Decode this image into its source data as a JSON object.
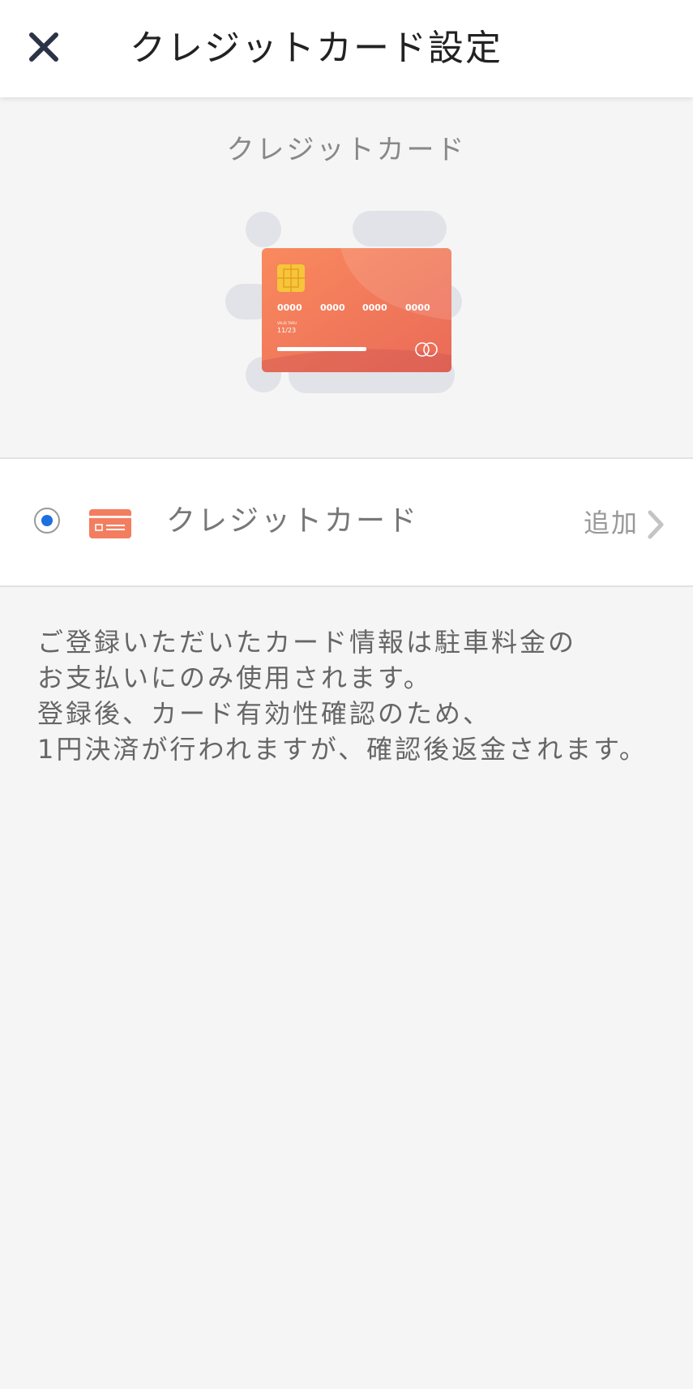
{
  "header": {
    "title": "クレジットカード設定",
    "close_icon": "close-icon"
  },
  "hero": {
    "label": "クレジットカード",
    "card": {
      "number_groups": [
        "0000",
        "0000",
        "0000",
        "0000"
      ],
      "valid_thru_label": "VALID THRU",
      "expiry": "11/23"
    }
  },
  "payment_method": {
    "selected": true,
    "icon": "credit-card-icon",
    "label": "クレジットカード",
    "action_label": "追加",
    "chevron_icon": "chevron-right-icon"
  },
  "notice": {
    "lines": [
      "ご登録いただいたカード情報は駐車料金の",
      "お支払いにのみ使用されます。",
      "登録後、カード有効性確認のため、",
      "1円決済が行われますが、確認後返金されます。"
    ]
  },
  "colors": {
    "accent": "#1e6fe0",
    "card_orange": "#f07a5c",
    "background": "#f5f5f5"
  }
}
